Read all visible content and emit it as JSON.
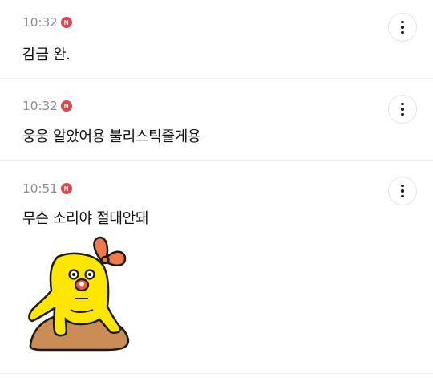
{
  "messages": [
    {
      "time": "10:32",
      "badge": "N",
      "text": "감금 완."
    },
    {
      "time": "10:32",
      "badge": "N",
      "text": "웅웅 알았어용 불리스틱줄게용"
    },
    {
      "time": "10:51",
      "badge": "N",
      "text": "무슨 소리야 절대안돼"
    }
  ],
  "icons": {
    "more": "more-vertical-icon",
    "badge": "new-badge-icon",
    "sticker": "yellow-chick-sticker"
  },
  "colors": {
    "badge": "#e2474f",
    "time": "#8e8e8e",
    "text": "#111111",
    "divider": "#ececec",
    "sticker_body": "#ffe600",
    "sticker_bow": "#ee7a4e",
    "sticker_ground": "#c98d55"
  }
}
